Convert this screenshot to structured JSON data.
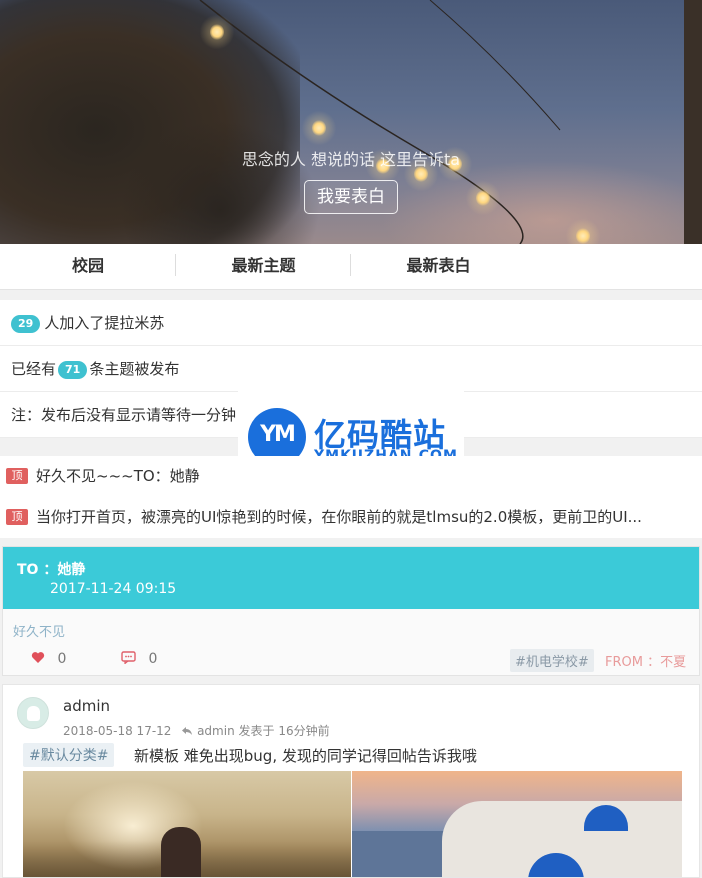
{
  "hero": {
    "caption": "思念的人 想说的话 这里告诉ta",
    "button_label": "我要表白"
  },
  "tabs": [
    {
      "label": "校园"
    },
    {
      "label": "最新主题"
    },
    {
      "label": "最新表白"
    }
  ],
  "stats": {
    "members_count": "29",
    "members_text": "人加入了提拉米苏",
    "topics_prefix": "已经有",
    "topics_count": "71",
    "topics_suffix": "条主题被发布",
    "notice": "注：发布后没有显示请等待一分钟"
  },
  "watermark": {
    "logo_text": "YM",
    "title": "亿码酷站",
    "subtitle": "YMKUZHAN.COM"
  },
  "pinned": {
    "badge": "顶",
    "items": [
      {
        "title": "好久不见~~~TO：她静"
      },
      {
        "title": "当你打开首页，被漂亮的UI惊艳到的时候，在你眼前的就是tlmsu的2.0模板，更前卫的UI..."
      }
    ]
  },
  "confession": {
    "to_label": "TO ：她静",
    "date": "2017-11-24 09:15",
    "body": "好久不见",
    "likes": "0",
    "comments": "0",
    "tag": "#机电学校#",
    "from": "FROM ：不夏"
  },
  "post": {
    "username": "admin",
    "date": "2018-05-18 17-12",
    "reply_user": "admin",
    "reply_text": "发表于 16分钟前",
    "category": "#默认分类#",
    "text": "新模板 难免出现bug, 发现的同学记得回帖告诉我哦"
  },
  "colors": {
    "accent": "#3bcad8",
    "pin_badge": "#e0605f",
    "watermark_blue": "#1a6fdc"
  }
}
